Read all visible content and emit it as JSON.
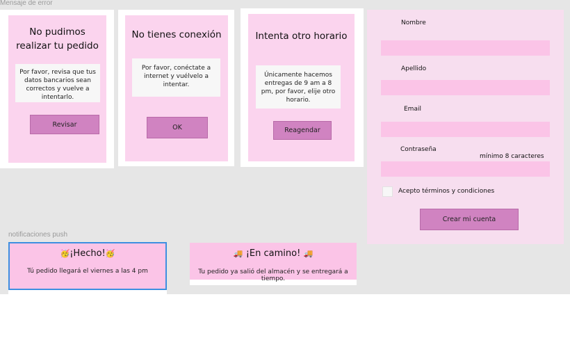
{
  "sections": {
    "errors_label": "Mensaje de error",
    "push_label": "notificaciones push"
  },
  "error_cards": [
    {
      "title": "No pudimos realizar tu pedido",
      "message": "Por favor, revisa que tus datos bancarios sean correctos y vuelve a intentarlo.",
      "button": "Revisar"
    },
    {
      "title": "No tienes conexión",
      "message": "Por favor, conéctate a internet y vuélvelo a intentar.",
      "button": "OK"
    },
    {
      "title": "Intenta otro horario",
      "message": "Únicamente hacemos entregas de 9 am a 8 pm, por favor, elije otro horario.",
      "button": "Reagendar"
    }
  ],
  "signup_form": {
    "fields": [
      {
        "label": "Nombre",
        "value": ""
      },
      {
        "label": "Apellido",
        "value": ""
      },
      {
        "label": "Email",
        "value": ""
      },
      {
        "label": "Contraseña",
        "value": ""
      }
    ],
    "password_hint": "mínimo 8 caracteres",
    "terms_label": "Acepto términos y condiciones",
    "submit_label": "Crear mi cuenta"
  },
  "push_notifications": [
    {
      "emoji": "🥳",
      "title": "¡Hecho!",
      "body": "Tú pedido llegará el viernes a las 4 pm"
    },
    {
      "emoji": "🚚",
      "title": "¡En camino!",
      "body": "Tu pedido ya salió del almacén y se entregará a tiempo."
    }
  ],
  "colors": {
    "canvas": "#e6e6e6",
    "card_pink": "#fbd4ee",
    "input_pink": "#fbc4e7",
    "button_purple": "#d083c1",
    "selection_blue": "#3d8fe0"
  }
}
